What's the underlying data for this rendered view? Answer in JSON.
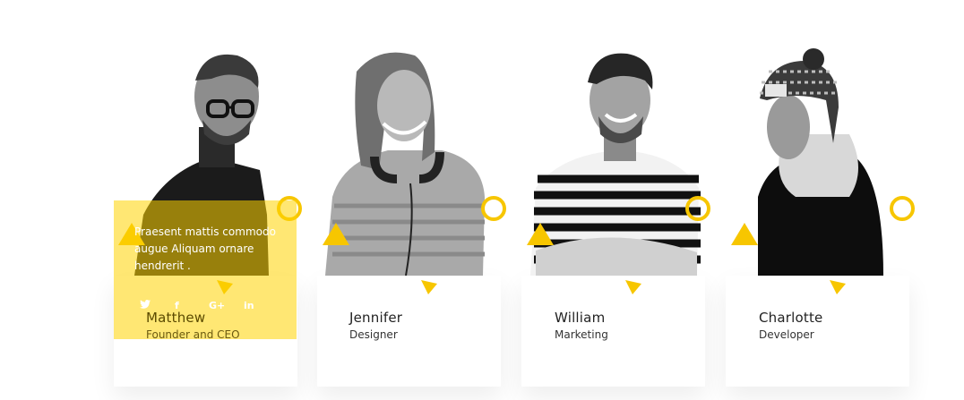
{
  "team": {
    "members": [
      {
        "name": "Matthew",
        "role": "Founder and CEO",
        "photo_icon": "person-photo"
      },
      {
        "name": "Jennifer",
        "role": "Designer",
        "photo_icon": "person-photo"
      },
      {
        "name": "William",
        "role": "Marketing",
        "photo_icon": "person-photo"
      },
      {
        "name": "Charlotte",
        "role": "Developer",
        "photo_icon": "person-photo"
      }
    ],
    "hover": {
      "description": "Praesent mattis commodo augue Aliquam ornare hendrerit .",
      "social": [
        "twitter-icon",
        "facebook-icon",
        "google-plus-icon",
        "linkedin-icon"
      ]
    }
  },
  "colors": {
    "accent": "#f7c600",
    "overlay": "#ffd400"
  }
}
